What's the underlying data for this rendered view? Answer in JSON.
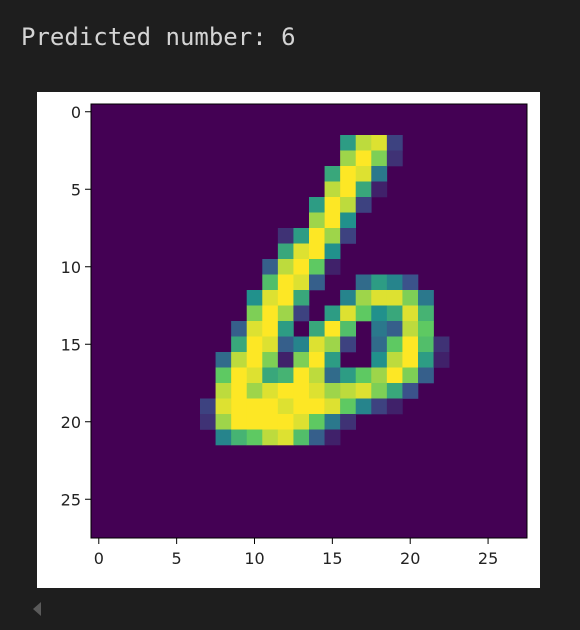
{
  "output": {
    "label": "Predicted number:",
    "value": "6"
  },
  "colors": {
    "background": "#1e1e1e",
    "text": "#d4d4d4",
    "figure_bg": "#ffffff",
    "colormap": "viridis"
  },
  "chart_data": {
    "type": "heatmap",
    "title": "",
    "xlabel": "",
    "ylabel": "",
    "xlim": [
      -0.5,
      27.5
    ],
    "ylim": [
      27.5,
      -0.5
    ],
    "x_ticks": [
      0,
      5,
      10,
      15,
      20,
      25
    ],
    "y_ticks": [
      0,
      5,
      10,
      15,
      20,
      25
    ],
    "x_tick_labels": [
      "0",
      "5",
      "10",
      "15",
      "20",
      "25"
    ],
    "y_tick_labels": [
      "0",
      "5",
      "10",
      "15",
      "20",
      "25"
    ],
    "value_range": [
      0,
      1
    ],
    "grid": false,
    "pixels": [
      [
        16,
        2,
        0.55
      ],
      [
        17,
        2,
        0.9
      ],
      [
        18,
        2,
        0.95
      ],
      [
        19,
        2,
        0.2
      ],
      [
        16,
        3,
        0.85
      ],
      [
        17,
        3,
        1.0
      ],
      [
        18,
        3,
        0.8
      ],
      [
        19,
        3,
        0.15
      ],
      [
        15,
        4,
        0.6
      ],
      [
        16,
        4,
        1.0
      ],
      [
        17,
        4,
        0.95
      ],
      [
        18,
        4,
        0.4
      ],
      [
        15,
        5,
        0.9
      ],
      [
        16,
        5,
        1.0
      ],
      [
        17,
        5,
        0.6
      ],
      [
        18,
        5,
        0.1
      ],
      [
        14,
        6,
        0.55
      ],
      [
        15,
        6,
        1.0
      ],
      [
        16,
        6,
        0.9
      ],
      [
        17,
        6,
        0.2
      ],
      [
        14,
        7,
        0.85
      ],
      [
        15,
        7,
        1.0
      ],
      [
        16,
        7,
        0.5
      ],
      [
        12,
        8,
        0.15
      ],
      [
        13,
        8,
        0.55
      ],
      [
        14,
        8,
        1.0
      ],
      [
        15,
        8,
        0.85
      ],
      [
        16,
        8,
        0.2
      ],
      [
        12,
        9,
        0.6
      ],
      [
        13,
        9,
        0.95
      ],
      [
        14,
        9,
        1.0
      ],
      [
        15,
        9,
        0.5
      ],
      [
        11,
        10,
        0.3
      ],
      [
        12,
        10,
        0.9
      ],
      [
        13,
        10,
        1.0
      ],
      [
        14,
        10,
        0.75
      ],
      [
        15,
        10,
        0.1
      ],
      [
        11,
        11,
        0.7
      ],
      [
        12,
        11,
        1.0
      ],
      [
        13,
        11,
        0.95
      ],
      [
        14,
        11,
        0.3
      ],
      [
        17,
        11,
        0.35
      ],
      [
        18,
        11,
        0.55
      ],
      [
        19,
        11,
        0.45
      ],
      [
        20,
        11,
        0.25
      ],
      [
        10,
        12,
        0.5
      ],
      [
        11,
        12,
        0.95
      ],
      [
        12,
        12,
        1.0
      ],
      [
        13,
        12,
        0.6
      ],
      [
        16,
        12,
        0.45
      ],
      [
        17,
        12,
        0.85
      ],
      [
        18,
        12,
        0.95
      ],
      [
        19,
        12,
        0.95
      ],
      [
        20,
        12,
        0.8
      ],
      [
        21,
        12,
        0.4
      ],
      [
        10,
        13,
        0.8
      ],
      [
        11,
        13,
        1.0
      ],
      [
        12,
        13,
        0.85
      ],
      [
        13,
        13,
        0.2
      ],
      [
        15,
        13,
        0.55
      ],
      [
        16,
        13,
        0.95
      ],
      [
        17,
        13,
        0.75
      ],
      [
        18,
        13,
        0.5
      ],
      [
        19,
        13,
        0.6
      ],
      [
        20,
        13,
        0.95
      ],
      [
        21,
        13,
        0.65
      ],
      [
        9,
        14,
        0.3
      ],
      [
        10,
        14,
        0.95
      ],
      [
        11,
        14,
        1.0
      ],
      [
        12,
        14,
        0.55
      ],
      [
        14,
        14,
        0.6
      ],
      [
        15,
        14,
        1.0
      ],
      [
        16,
        14,
        0.7
      ],
      [
        18,
        14,
        0.4
      ],
      [
        19,
        14,
        0.3
      ],
      [
        20,
        14,
        0.9
      ],
      [
        21,
        14,
        0.75
      ],
      [
        9,
        15,
        0.6
      ],
      [
        10,
        15,
        1.0
      ],
      [
        11,
        15,
        0.95
      ],
      [
        12,
        15,
        0.3
      ],
      [
        13,
        15,
        0.45
      ],
      [
        14,
        15,
        0.95
      ],
      [
        15,
        15,
        0.85
      ],
      [
        16,
        15,
        0.2
      ],
      [
        18,
        15,
        0.35
      ],
      [
        19,
        15,
        0.75
      ],
      [
        20,
        15,
        1.0
      ],
      [
        21,
        15,
        0.7
      ],
      [
        22,
        15,
        0.15
      ],
      [
        8,
        16,
        0.35
      ],
      [
        9,
        16,
        0.9
      ],
      [
        10,
        16,
        1.0
      ],
      [
        11,
        16,
        0.8
      ],
      [
        12,
        16,
        0.1
      ],
      [
        13,
        16,
        0.8
      ],
      [
        14,
        16,
        1.0
      ],
      [
        15,
        16,
        0.55
      ],
      [
        18,
        16,
        0.5
      ],
      [
        19,
        16,
        0.9
      ],
      [
        20,
        16,
        1.0
      ],
      [
        21,
        16,
        0.55
      ],
      [
        22,
        16,
        0.1
      ],
      [
        8,
        17,
        0.75
      ],
      [
        9,
        17,
        1.0
      ],
      [
        10,
        17,
        0.95
      ],
      [
        11,
        17,
        0.6
      ],
      [
        12,
        17,
        0.65
      ],
      [
        13,
        17,
        1.0
      ],
      [
        14,
        17,
        0.9
      ],
      [
        15,
        17,
        0.35
      ],
      [
        16,
        17,
        0.55
      ],
      [
        17,
        17,
        0.75
      ],
      [
        18,
        17,
        0.85
      ],
      [
        19,
        17,
        1.0
      ],
      [
        20,
        17,
        0.8
      ],
      [
        21,
        17,
        0.3
      ],
      [
        8,
        18,
        0.9
      ],
      [
        9,
        18,
        1.0
      ],
      [
        10,
        18,
        0.85
      ],
      [
        11,
        18,
        0.95
      ],
      [
        12,
        18,
        1.0
      ],
      [
        13,
        18,
        1.0
      ],
      [
        14,
        18,
        0.95
      ],
      [
        15,
        18,
        0.85
      ],
      [
        16,
        18,
        0.9
      ],
      [
        17,
        18,
        0.95
      ],
      [
        18,
        18,
        0.8
      ],
      [
        19,
        18,
        0.6
      ],
      [
        20,
        18,
        0.25
      ],
      [
        7,
        19,
        0.2
      ],
      [
        8,
        19,
        0.95
      ],
      [
        9,
        19,
        1.0
      ],
      [
        10,
        19,
        1.0
      ],
      [
        11,
        19,
        1.0
      ],
      [
        12,
        19,
        0.95
      ],
      [
        13,
        19,
        1.0
      ],
      [
        14,
        19,
        1.0
      ],
      [
        15,
        19,
        0.95
      ],
      [
        16,
        19,
        0.75
      ],
      [
        17,
        19,
        0.45
      ],
      [
        18,
        19,
        0.2
      ],
      [
        19,
        19,
        0.1
      ],
      [
        7,
        20,
        0.15
      ],
      [
        8,
        20,
        0.85
      ],
      [
        9,
        20,
        1.0
      ],
      [
        10,
        20,
        1.0
      ],
      [
        11,
        20,
        1.0
      ],
      [
        12,
        20,
        1.0
      ],
      [
        13,
        20,
        0.95
      ],
      [
        14,
        20,
        0.75
      ],
      [
        15,
        20,
        0.4
      ],
      [
        16,
        20,
        0.15
      ],
      [
        8,
        21,
        0.45
      ],
      [
        9,
        21,
        0.65
      ],
      [
        10,
        21,
        0.75
      ],
      [
        11,
        21,
        0.9
      ],
      [
        12,
        21,
        0.95
      ],
      [
        13,
        21,
        0.7
      ],
      [
        14,
        21,
        0.3
      ],
      [
        15,
        21,
        0.1
      ]
    ]
  }
}
